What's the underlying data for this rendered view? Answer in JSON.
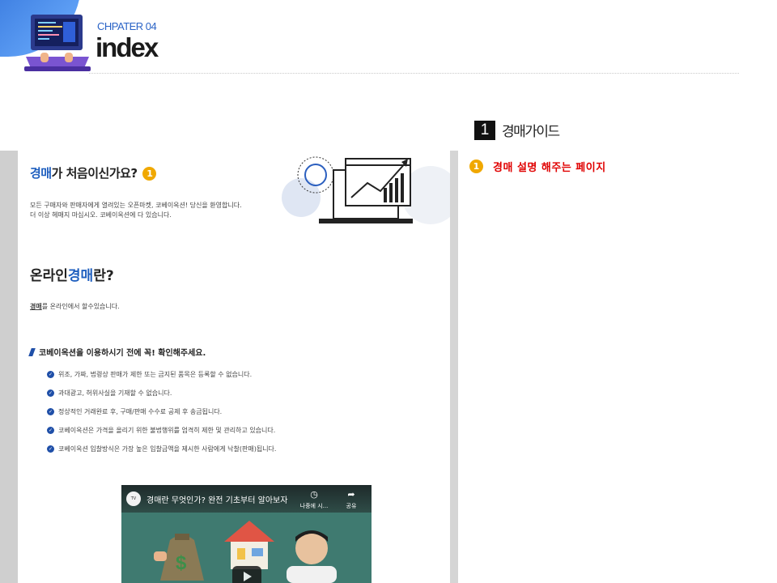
{
  "header": {
    "chapter": "CHPATER 04",
    "title": "index"
  },
  "section": {
    "number": "1",
    "title": "경매가이드"
  },
  "panel": {
    "first_heading_blue": "경매",
    "first_heading_rest": "가 처음이신가요?",
    "first_badge": "1",
    "intro_line1": "모든 구매자와 판매자에게 열려있는 오픈마켓, 코베이옥션! 당신을 환영합니다.",
    "intro_line2": "더 이상 헤매지 마십시오. 코베이옥션에 다 있습니다.",
    "online_heading_pre": "온라인",
    "online_heading_blue": "경매",
    "online_heading_post": "란?",
    "online_desc_underlined": "경매",
    "online_desc_rest": "를 온라인에서 할수있습니다.",
    "notice_title": "코베이옥션을 이용하시기 전에 꼭! 확인해주세요.",
    "rules": [
      "위조, 가짜, 법령상 판매가 제한 또는 금지된 품목은 등록할 수 없습니다.",
      "과대광고, 허위사실을 기재할 수 없습니다.",
      "정상적인 거래완료 후, 구매/판매 수수료 공제 후 송금됩니다.",
      "코베이옥션은 가격을 올리기 위한 불법행위를 엄격히 제한 및 관리하고 있습니다.",
      "코베이옥션 입찰방식은 가장 높은 입찰금액을 제시한 사람에게 낙찰(판매)됩니다."
    ],
    "video": {
      "title": "경매란 무엇인가? 완전 기초부터 알아보자",
      "watch_later": "나중에 시...",
      "share": "공유"
    }
  },
  "note": {
    "badge": "1",
    "text": "경매 설명 해주는 페이지"
  },
  "colors": {
    "accent_blue": "#1f5fbf",
    "badge_orange": "#f0a800",
    "note_red": "#e00000"
  }
}
